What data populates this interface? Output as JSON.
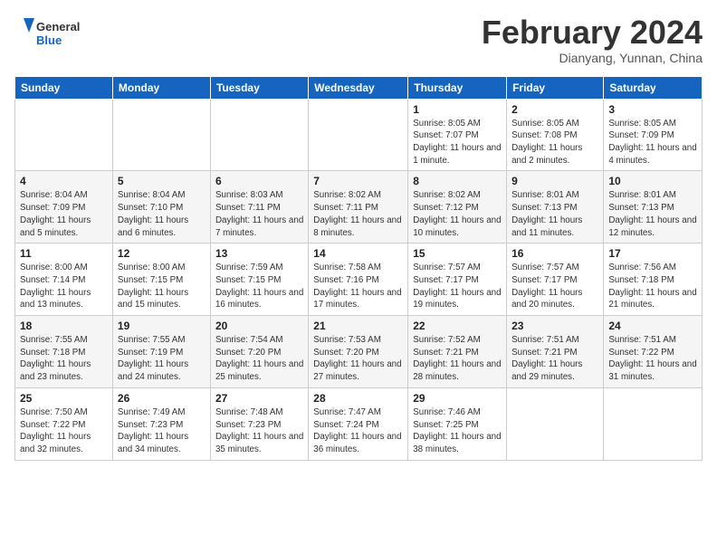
{
  "header": {
    "logo_line1": "General",
    "logo_line2": "Blue",
    "month_title": "February 2024",
    "subtitle": "Dianyang, Yunnan, China"
  },
  "days_of_week": [
    "Sunday",
    "Monday",
    "Tuesday",
    "Wednesday",
    "Thursday",
    "Friday",
    "Saturday"
  ],
  "weeks": [
    [
      {
        "day": "",
        "info": ""
      },
      {
        "day": "",
        "info": ""
      },
      {
        "day": "",
        "info": ""
      },
      {
        "day": "",
        "info": ""
      },
      {
        "day": "1",
        "info": "Sunrise: 8:05 AM\nSunset: 7:07 PM\nDaylight: 11 hours and 1 minute."
      },
      {
        "day": "2",
        "info": "Sunrise: 8:05 AM\nSunset: 7:08 PM\nDaylight: 11 hours and 2 minutes."
      },
      {
        "day": "3",
        "info": "Sunrise: 8:05 AM\nSunset: 7:09 PM\nDaylight: 11 hours and 4 minutes."
      }
    ],
    [
      {
        "day": "4",
        "info": "Sunrise: 8:04 AM\nSunset: 7:09 PM\nDaylight: 11 hours and 5 minutes."
      },
      {
        "day": "5",
        "info": "Sunrise: 8:04 AM\nSunset: 7:10 PM\nDaylight: 11 hours and 6 minutes."
      },
      {
        "day": "6",
        "info": "Sunrise: 8:03 AM\nSunset: 7:11 PM\nDaylight: 11 hours and 7 minutes."
      },
      {
        "day": "7",
        "info": "Sunrise: 8:02 AM\nSunset: 7:11 PM\nDaylight: 11 hours and 8 minutes."
      },
      {
        "day": "8",
        "info": "Sunrise: 8:02 AM\nSunset: 7:12 PM\nDaylight: 11 hours and 10 minutes."
      },
      {
        "day": "9",
        "info": "Sunrise: 8:01 AM\nSunset: 7:13 PM\nDaylight: 11 hours and 11 minutes."
      },
      {
        "day": "10",
        "info": "Sunrise: 8:01 AM\nSunset: 7:13 PM\nDaylight: 11 hours and 12 minutes."
      }
    ],
    [
      {
        "day": "11",
        "info": "Sunrise: 8:00 AM\nSunset: 7:14 PM\nDaylight: 11 hours and 13 minutes."
      },
      {
        "day": "12",
        "info": "Sunrise: 8:00 AM\nSunset: 7:15 PM\nDaylight: 11 hours and 15 minutes."
      },
      {
        "day": "13",
        "info": "Sunrise: 7:59 AM\nSunset: 7:15 PM\nDaylight: 11 hours and 16 minutes."
      },
      {
        "day": "14",
        "info": "Sunrise: 7:58 AM\nSunset: 7:16 PM\nDaylight: 11 hours and 17 minutes."
      },
      {
        "day": "15",
        "info": "Sunrise: 7:57 AM\nSunset: 7:17 PM\nDaylight: 11 hours and 19 minutes."
      },
      {
        "day": "16",
        "info": "Sunrise: 7:57 AM\nSunset: 7:17 PM\nDaylight: 11 hours and 20 minutes."
      },
      {
        "day": "17",
        "info": "Sunrise: 7:56 AM\nSunset: 7:18 PM\nDaylight: 11 hours and 21 minutes."
      }
    ],
    [
      {
        "day": "18",
        "info": "Sunrise: 7:55 AM\nSunset: 7:18 PM\nDaylight: 11 hours and 23 minutes."
      },
      {
        "day": "19",
        "info": "Sunrise: 7:55 AM\nSunset: 7:19 PM\nDaylight: 11 hours and 24 minutes."
      },
      {
        "day": "20",
        "info": "Sunrise: 7:54 AM\nSunset: 7:20 PM\nDaylight: 11 hours and 25 minutes."
      },
      {
        "day": "21",
        "info": "Sunrise: 7:53 AM\nSunset: 7:20 PM\nDaylight: 11 hours and 27 minutes."
      },
      {
        "day": "22",
        "info": "Sunrise: 7:52 AM\nSunset: 7:21 PM\nDaylight: 11 hours and 28 minutes."
      },
      {
        "day": "23",
        "info": "Sunrise: 7:51 AM\nSunset: 7:21 PM\nDaylight: 11 hours and 29 minutes."
      },
      {
        "day": "24",
        "info": "Sunrise: 7:51 AM\nSunset: 7:22 PM\nDaylight: 11 hours and 31 minutes."
      }
    ],
    [
      {
        "day": "25",
        "info": "Sunrise: 7:50 AM\nSunset: 7:22 PM\nDaylight: 11 hours and 32 minutes."
      },
      {
        "day": "26",
        "info": "Sunrise: 7:49 AM\nSunset: 7:23 PM\nDaylight: 11 hours and 34 minutes."
      },
      {
        "day": "27",
        "info": "Sunrise: 7:48 AM\nSunset: 7:23 PM\nDaylight: 11 hours and 35 minutes."
      },
      {
        "day": "28",
        "info": "Sunrise: 7:47 AM\nSunset: 7:24 PM\nDaylight: 11 hours and 36 minutes."
      },
      {
        "day": "29",
        "info": "Sunrise: 7:46 AM\nSunset: 7:25 PM\nDaylight: 11 hours and 38 minutes."
      },
      {
        "day": "",
        "info": ""
      },
      {
        "day": "",
        "info": ""
      }
    ]
  ]
}
